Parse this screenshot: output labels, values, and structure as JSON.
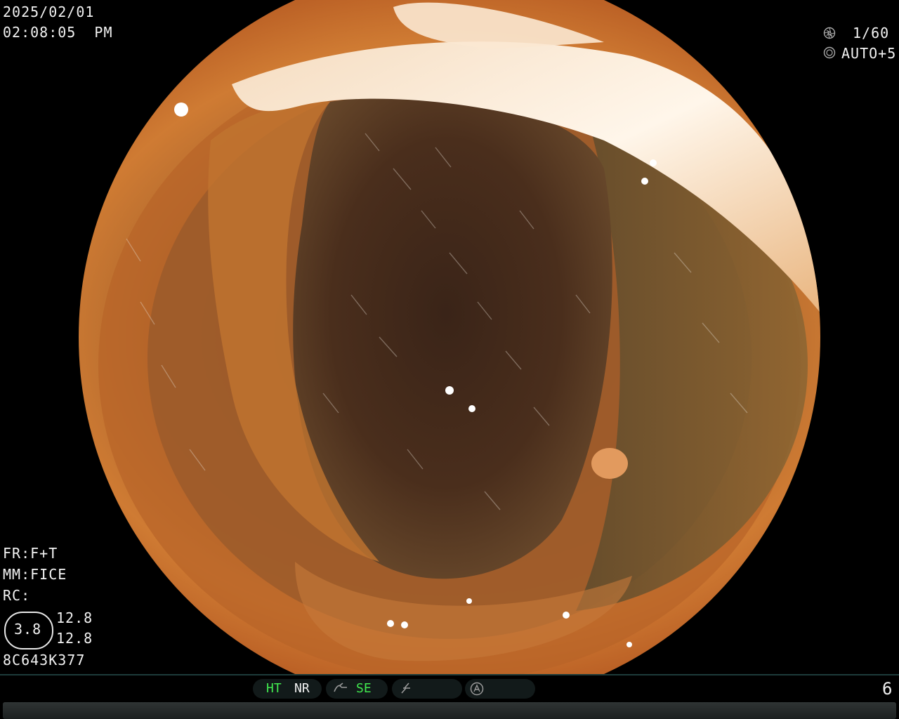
{
  "top_left": {
    "date": "2025/02/01",
    "time": "02:08:05  PM"
  },
  "top_right": {
    "shutter_icon": "aperture-icon",
    "shutter": "1/60",
    "iris_icon": "iris-icon",
    "iris": "AUTO+5"
  },
  "bottom_left": {
    "fr": "FR:F+T",
    "mm": "MM:FICE",
    "rc": "RC:",
    "zoom_value": "3.8",
    "value_a": "12.8",
    "value_b": "12.8",
    "serial": "8C643K377"
  },
  "status_bar": {
    "ht": "HT",
    "nr": "NR",
    "curve_icon": "curve-icon",
    "se": "SE",
    "lightning_icon": "flash-icon",
    "auto_icon": "auto-a-icon",
    "page_number": "6"
  },
  "colors": {
    "status_green": "#41e84f",
    "tissue_orange": "#c7652a",
    "lumen_dark": "#2d1b12"
  }
}
